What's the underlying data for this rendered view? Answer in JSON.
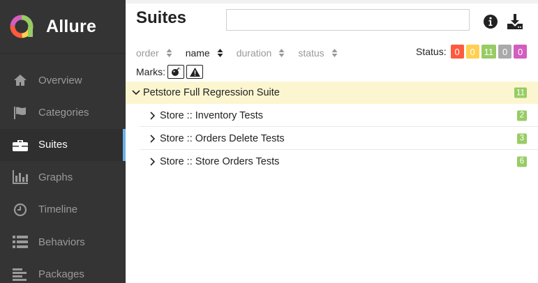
{
  "brand": {
    "name": "Allure"
  },
  "sidebar": {
    "items": [
      {
        "label": "Overview",
        "icon": "home-icon"
      },
      {
        "label": "Categories",
        "icon": "flag-icon"
      },
      {
        "label": "Suites",
        "icon": "briefcase-icon",
        "active": true
      },
      {
        "label": "Graphs",
        "icon": "bar-chart-icon"
      },
      {
        "label": "Timeline",
        "icon": "clock-icon"
      },
      {
        "label": "Behaviors",
        "icon": "list-icon"
      },
      {
        "label": "Packages",
        "icon": "align-left-icon"
      }
    ],
    "active_color": "#6db1e9"
  },
  "header": {
    "title": "Suites",
    "search": {
      "value": "",
      "placeholder": ""
    }
  },
  "sort": {
    "columns": [
      {
        "label": "order",
        "active": false
      },
      {
        "label": "name",
        "active": true
      },
      {
        "label": "duration",
        "active": false
      },
      {
        "label": "status",
        "active": false
      }
    ]
  },
  "status": {
    "label": "Status:",
    "badges": [
      {
        "key": "failed",
        "value": "0",
        "color": "#fd5a3e"
      },
      {
        "key": "broken",
        "value": "0",
        "color": "#ffd050"
      },
      {
        "key": "passed",
        "value": "11",
        "color": "#97cc64"
      },
      {
        "key": "skipped",
        "value": "0",
        "color": "#aaaaaa"
      },
      {
        "key": "unknown",
        "value": "0",
        "color": "#d35ebe"
      }
    ]
  },
  "marks": {
    "label": "Marks:",
    "items": [
      "flaky-bomb-icon",
      "warning-icon"
    ]
  },
  "tree": {
    "group": {
      "label": "Petstore Full Regression Suite",
      "count": "11"
    },
    "children": [
      {
        "label": "Store :: Inventory Tests",
        "count": "2"
      },
      {
        "label": "Store :: Orders Delete Tests",
        "count": "3"
      },
      {
        "label": "Store :: Store Orders Tests",
        "count": "6"
      }
    ]
  }
}
